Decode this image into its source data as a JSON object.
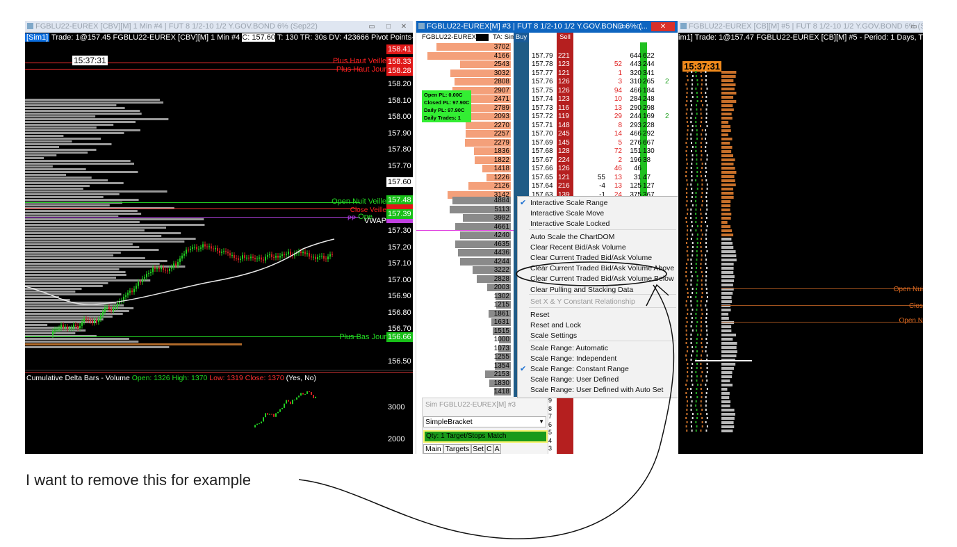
{
  "left_window": {
    "title": "FGBLU22-EUREX [CBV][M]  1 Min  #4 | FUT 8 1/2-10 1/2 Y.GOV.BOND 6% (Sep22)",
    "info": {
      "sim": "[Sim1]",
      "trade": "Trade: 1@157.45",
      "symbol": "FGBLU22-EUREX [CBV][M]  1 Min  #4",
      "close": "C: 157.60",
      "rest": "T: 130 TR: 30s DV: 423666 Pivot Points-Daily  OHL"
    },
    "clock": "15:37:31",
    "levels": [
      {
        "label": "Plus Haut Veille",
        "price": "158.33",
        "color": "#ff2020"
      },
      {
        "label": "Plus Haut Jour",
        "price": "158.28",
        "color": "#ff2020"
      },
      {
        "label": "Open Nuit Veille",
        "price": "157.48",
        "color": "#22dd22"
      },
      {
        "label": "Close Veille",
        "price": "157.43",
        "color": "#ff2020"
      },
      {
        "label": "Ope",
        "price": "157.39",
        "color": "#22dd22"
      },
      {
        "label": "VWAP",
        "price": "157.35",
        "color": "#ffffff"
      },
      {
        "label": "PP",
        "price": "",
        "color": "#c040ff"
      },
      {
        "label": "Plus Bas Jour",
        "price": "156.66",
        "color": "#22dd22"
      }
    ],
    "top_price": "158.41",
    "axis_prices": [
      "158.20",
      "158.10",
      "158.00",
      "157.90",
      "157.80",
      "157.70",
      "157.30",
      "157.20",
      "157.10",
      "157.00",
      "156.90",
      "156.80",
      "156.70",
      "156.50"
    ],
    "last_price": "157.60",
    "delta": {
      "title": "Cumulative Delta Bars - Volume",
      "open": "Open: 1326",
      "high": "High: 1370",
      "low": "Low: 1319",
      "close": "Close: 1370",
      "params": "(Yes, No)",
      "axis": [
        "3000",
        "2000"
      ]
    }
  },
  "mid_window": {
    "title": "FGBLU22-EUREX[M]  #3 | FUT 8 1/2-10 1/2 Y.GOV.BOND 6% (...",
    "symbol": "FGBLU22-EUREX[M]",
    "ta": "TA: Sim",
    "buy": "Buy",
    "sell": "Sell",
    "pl": {
      "open": "Open PL: 0.00C",
      "closed": "Closed PL: 97.90C",
      "daily": "Daily PL: 97.90C",
      "trades": "Daily Trades: 1"
    },
    "ask_rows": [
      {
        "vol": "3702",
        "price": "",
        "sell": "",
        "a": "",
        "b": "",
        "c": "",
        "d": "",
        "e": ""
      },
      {
        "vol": "4166",
        "price": "157.79",
        "sell": "221",
        "a": "",
        "b": "",
        "c": "644",
        "d": "622",
        "e": ""
      },
      {
        "vol": "2543",
        "price": "157.78",
        "sell": "123",
        "a": "",
        "b": "52",
        "c": "443",
        "d": "244",
        "e": ""
      },
      {
        "vol": "3032",
        "price": "157.77",
        "sell": "121",
        "a": "",
        "b": "1",
        "c": "320",
        "d": "341",
        "e": ""
      },
      {
        "vol": "2808",
        "price": "157.76",
        "sell": "126",
        "a": "",
        "b": "3",
        "c": "310",
        "d": "265",
        "e": "2"
      },
      {
        "vol": "2907",
        "price": "157.75",
        "sell": "126",
        "a": "",
        "b": "94",
        "c": "466",
        "d": "184",
        "e": ""
      },
      {
        "vol": "2471",
        "price": "157.74",
        "sell": "123",
        "a": "",
        "b": "10",
        "c": "284",
        "d": "248",
        "e": ""
      },
      {
        "vol": "2789",
        "price": "157.73",
        "sell": "116",
        "a": "",
        "b": "13",
        "c": "290",
        "d": "298",
        "e": ""
      },
      {
        "vol": "2093",
        "price": "157.72",
        "sell": "119",
        "a": "",
        "b": "29",
        "c": "244",
        "d": "169",
        "e": "2"
      },
      {
        "vol": "2270",
        "price": "157.71",
        "sell": "148",
        "a": "",
        "b": "8",
        "c": "293",
        "d": "228",
        "e": ""
      },
      {
        "vol": "2257",
        "price": "157.70",
        "sell": "245",
        "a": "",
        "b": "14",
        "c": "466",
        "d": "292",
        "e": ""
      },
      {
        "vol": "2279",
        "price": "157.69",
        "sell": "145",
        "a": "",
        "b": "5",
        "c": "276",
        "d": "667",
        "e": ""
      },
      {
        "vol": "1836",
        "price": "157.68",
        "sell": "128",
        "a": "",
        "b": "72",
        "c": "151",
        "d": "130",
        "e": ""
      },
      {
        "vol": "1822",
        "price": "157.67",
        "sell": "224",
        "a": "",
        "b": "2",
        "c": "196",
        "d": "38",
        "e": ""
      },
      {
        "vol": "1418",
        "price": "157.66",
        "sell": "126",
        "a": "",
        "b": "46",
        "c": "46",
        "d": "",
        "e": ""
      },
      {
        "vol": "1226",
        "price": "157.65",
        "sell": "121",
        "a": "55",
        "b": "13",
        "c": "31",
        "d": "47",
        "e": ""
      },
      {
        "vol": "2126",
        "price": "157.64",
        "sell": "216",
        "a": "-4",
        "b": "13",
        "c": "125",
        "d": "127",
        "e": ""
      },
      {
        "vol": "3142",
        "price": "157.63",
        "sell": "139",
        "a": "-1",
        "b": "24",
        "c": "375",
        "d": "367",
        "e": ""
      }
    ],
    "bid_rows": [
      "4884",
      "5113",
      "3982",
      "4661",
      "4240",
      "4635",
      "4436",
      "4244",
      "3222",
      "2828",
      "2003",
      "1302",
      "1215",
      "1861",
      "1631",
      "1515",
      "1000",
      "1073",
      "1255",
      "1354",
      "2153",
      "1830",
      "1418"
    ],
    "order_panel": {
      "title": "Sim FGBLU22-EUREX[M]  #3",
      "strategy": "SimpleBracket",
      "qty": "Qty: 1 Target/Stops Match",
      "tabs": [
        "Main",
        "Targets",
        "Set",
        "C",
        "A"
      ],
      "side_nums": [
        "9",
        "8",
        "7",
        "6",
        "5",
        "4",
        "3"
      ]
    }
  },
  "context_menu": {
    "items": [
      {
        "label": "Interactive Scale Range",
        "checked": true,
        "disabled": false
      },
      {
        "label": "Interactive Scale Move",
        "checked": false,
        "disabled": false
      },
      {
        "label": "Interactive Scale Locked",
        "checked": false,
        "disabled": false
      },
      {
        "label": "Auto Scale the ChartDOM",
        "checked": false,
        "disabled": false
      },
      {
        "label": "Clear Recent Bid/Ask Volume",
        "checked": false,
        "disabled": false
      },
      {
        "label": "Clear Current Traded Bid/Ask Volume",
        "checked": false,
        "disabled": false
      },
      {
        "label": "Clear Current Traded Bid/Ask Volume Above",
        "checked": false,
        "disabled": false
      },
      {
        "label": "Clear Current Traded Bid/Ask Volume Below",
        "checked": false,
        "disabled": false
      },
      {
        "label": "Clear Pulling and Stacking Data",
        "checked": false,
        "disabled": false
      },
      {
        "label": "Set X & Y Constant Relationship",
        "checked": false,
        "disabled": true
      },
      {
        "label": "Reset",
        "checked": false,
        "disabled": false
      },
      {
        "label": "Reset and Lock",
        "checked": false,
        "disabled": false
      },
      {
        "label": "Scale Settings",
        "checked": false,
        "disabled": false
      },
      {
        "label": "Scale Range: Automatic",
        "checked": false,
        "disabled": false
      },
      {
        "label": "Scale Range: Independent",
        "checked": false,
        "disabled": false
      },
      {
        "label": "Scale Range: Constant Range",
        "checked": true,
        "disabled": false
      },
      {
        "label": "Scale Range: User Defined",
        "checked": false,
        "disabled": false
      },
      {
        "label": "Scale Range: User Defined with Auto Set",
        "checked": false,
        "disabled": false
      }
    ]
  },
  "right_window": {
    "title": "FGBLU22-EUREX [CB][M]  #5 | FUT 8 1/2-10 1/2 Y.GOV.BOND 6% (Sep22) (...",
    "info": "im1] Trade: 1@157.47 FGBLU22-EUREX [CB][M]  #5 - Period: 1 Days, TPOs: 0.01 x 30 min",
    "clock": "15:37:31",
    "labels": [
      "Open Nui",
      "Clos",
      "Open N"
    ]
  },
  "annotation": {
    "text": "I want to remove this for example"
  }
}
